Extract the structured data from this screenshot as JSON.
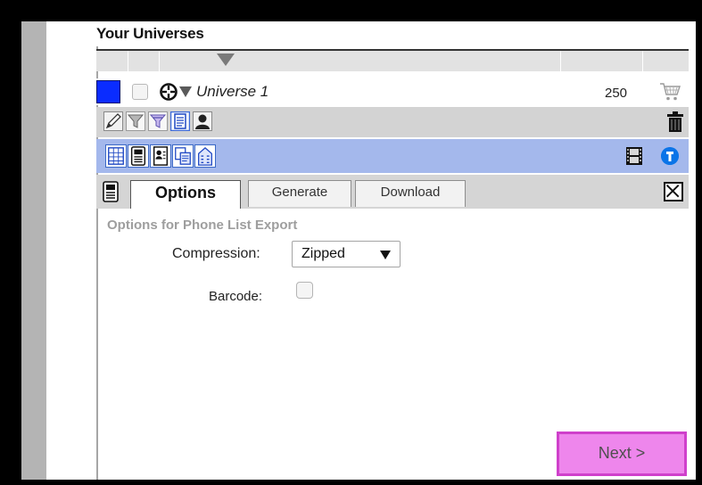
{
  "app": {
    "title": "Your Universes"
  },
  "universe": {
    "name": "Universe 1",
    "count": "250",
    "color": "#0a2cff"
  },
  "toolbar": {
    "tools": [
      "edit-icon",
      "filter-icon",
      "advanced-filter-icon",
      "list-icon",
      "person-icon"
    ],
    "trash": "trash-icon"
  },
  "export_bar": {
    "formats": [
      "spreadsheet-export-icon",
      "phone-list-export-icon",
      "contact-export-icon",
      "merge-export-icon",
      "building-export-icon"
    ],
    "film": "film-icon",
    "info": "info-icon",
    "color": "#a4b8ec"
  },
  "tabs": {
    "options": "Options",
    "generate": "Generate",
    "download": "Download"
  },
  "options": {
    "heading": "Options for Phone List Export",
    "compression_label": "Compression:",
    "compression_value": "Zipped",
    "barcode_label": "Barcode:",
    "barcode_checked": false
  },
  "actions": {
    "next_label": "Next >",
    "next_color": "#ee86ec"
  }
}
